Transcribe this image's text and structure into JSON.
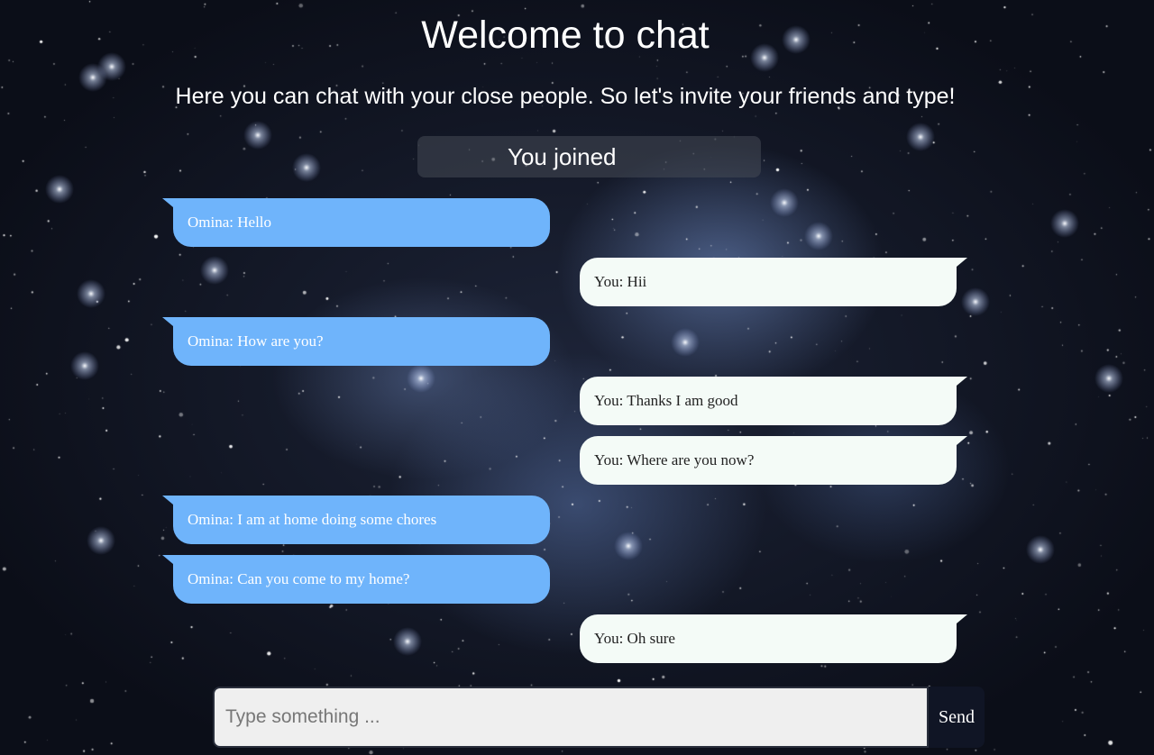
{
  "header": {
    "title": "Welcome to chat",
    "subtitle": "Here you can chat with your close people. So let's invite your friends and type!"
  },
  "status": {
    "joined_text": "You joined"
  },
  "messages": [
    {
      "direction": "incoming",
      "text": "Omina: Hello"
    },
    {
      "direction": "outgoing",
      "text": "You: Hii"
    },
    {
      "direction": "incoming",
      "text": "Omina: How are you?"
    },
    {
      "direction": "outgoing",
      "text": "You: Thanks I am good"
    },
    {
      "direction": "outgoing",
      "text": "You: Where are you now?"
    },
    {
      "direction": "incoming",
      "text": "Omina: I am at home doing some chores"
    },
    {
      "direction": "incoming",
      "text": "Omina: Can you come to my home?"
    },
    {
      "direction": "outgoing",
      "text": "You: Oh sure"
    }
  ],
  "composer": {
    "placeholder": "Type something ...",
    "value": "",
    "send_label": "Send"
  },
  "colors": {
    "incoming_bubble": "#6fb4fb",
    "outgoing_bubble": "#f4fbf7",
    "send_button": "#101525"
  }
}
